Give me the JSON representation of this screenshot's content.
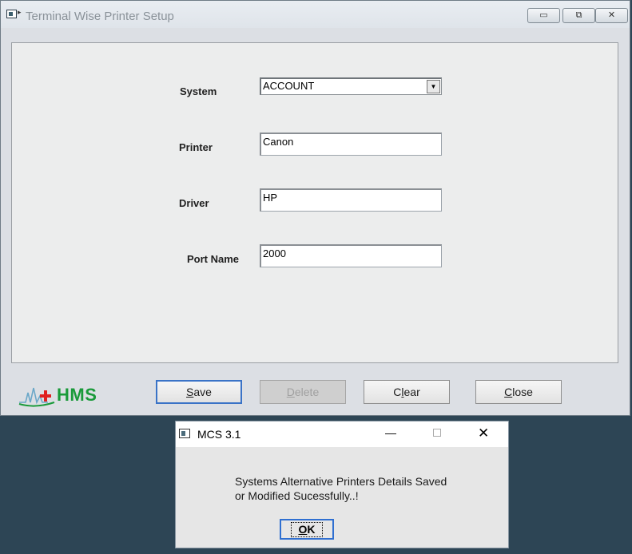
{
  "window": {
    "title": "Terminal Wise Printer Setup",
    "minimize_glyph": "▭",
    "restore_glyph": "⧉",
    "close_glyph": "✕"
  },
  "form": {
    "system_label": "System",
    "system_value": "ACCOUNT",
    "printer_label": "Printer",
    "printer_value": "Canon",
    "driver_label": "Driver",
    "driver_value": "HP",
    "port_label": "Port Name",
    "port_value": "2000"
  },
  "brand": {
    "logo_text": "HMS",
    "accent": "#1a9a3a",
    "cross_color": "#e02020"
  },
  "buttons": {
    "save_mnemonic": "S",
    "save_rest": "ave",
    "delete_mnemonic": "D",
    "delete_rest": "elete",
    "clear_pre": "C",
    "clear_mnemonic": "l",
    "clear_rest": "ear",
    "close_mnemonic": "C",
    "close_rest": "lose"
  },
  "dialog": {
    "title": "MCS 3.1",
    "minimize_glyph": "—",
    "close_glyph": "✕",
    "message": "Systems Alternative Printers Details Saved\nor Modified Sucessfully..!",
    "ok_mnemonic": "O",
    "ok_rest": "K"
  }
}
